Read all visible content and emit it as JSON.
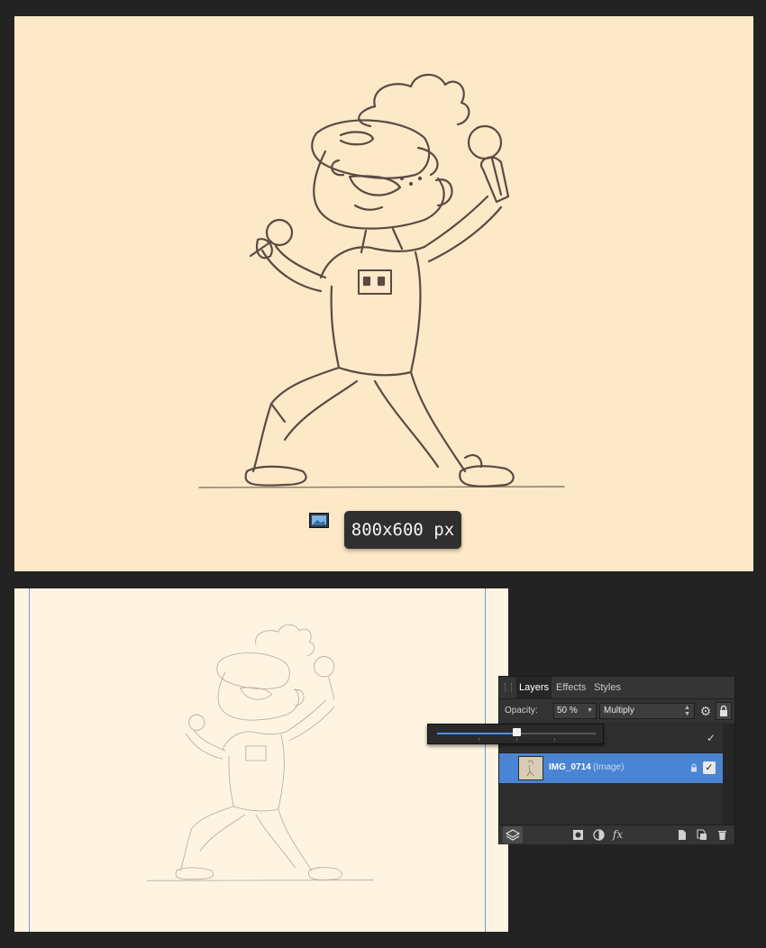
{
  "artwork": {
    "size_label": "800x600 px"
  },
  "layers_panel": {
    "tabs": [
      {
        "label": "Layers",
        "active": true
      },
      {
        "label": "Effects",
        "active": false
      },
      {
        "label": "Styles",
        "active": false
      }
    ],
    "opacity_label": "Opacity:",
    "opacity_value": "50 %",
    "blend_mode": "Multiply",
    "opacity_slider_fraction": 0.5,
    "layers": [
      {
        "name": "",
        "type": "",
        "visible": true,
        "selected": false
      },
      {
        "name": "IMG_0714",
        "type": "(Image)",
        "visible": true,
        "selected": true,
        "locked": true
      }
    ],
    "bottom_icons": [
      "layers-icon",
      "mask-icon",
      "adjustment-icon",
      "fx-icon",
      "new-layer-icon",
      "duplicate-icon",
      "trash-icon"
    ]
  },
  "colors": {
    "canvas_top": "#fde9c8",
    "canvas_bottom": "#fff4e2",
    "selection_blue": "#4a84d2",
    "guide_blue": "#6d9fd6"
  }
}
